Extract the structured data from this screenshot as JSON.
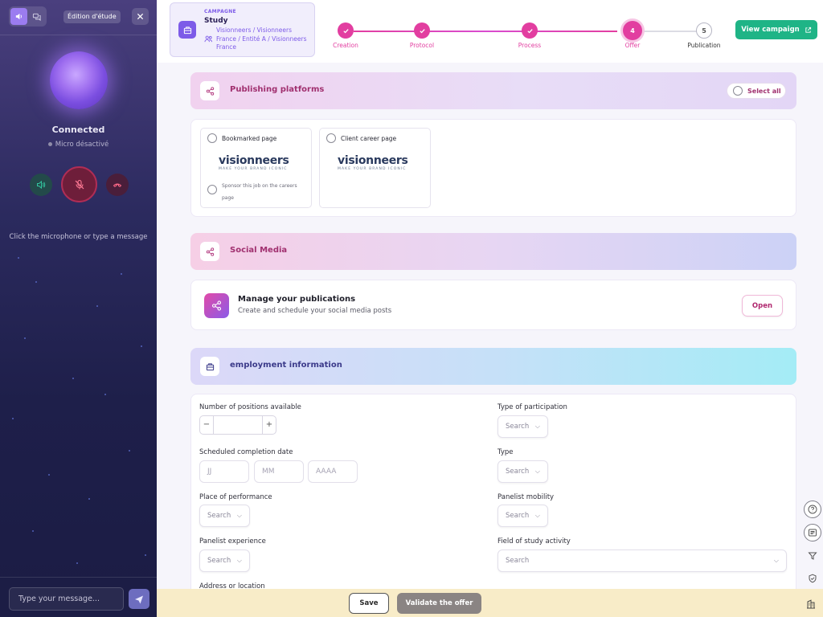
{
  "sidebar": {
    "edition_badge": "Édition d'étude",
    "status": "Connected",
    "mic_status": "Micro désactivé",
    "hint": "Click the microphone or type a message",
    "message_placeholder": "Type your message..."
  },
  "campaign": {
    "tag": "CAMPAGNE",
    "title": "Study",
    "path": "Visionneers / Visionneers France / Entité A / Visionneers France"
  },
  "steps": [
    {
      "label": "Creation",
      "state": "done"
    },
    {
      "label": "Protocol",
      "state": "done"
    },
    {
      "label": "Process",
      "state": "done"
    },
    {
      "label": "Offer",
      "number": "4",
      "state": "current"
    },
    {
      "label": "Publication",
      "number": "5",
      "state": "todo"
    }
  ],
  "view_campaign_label": "View campaign",
  "publishing": {
    "title": "Publishing platforms",
    "select_all": "Select all",
    "platforms": [
      {
        "label": "Bookmarked page",
        "logo": "visionneers",
        "logo_sub": "MAKE YOUR BRAND ICONIC",
        "sponsor": "Sponsor this job on the careers page"
      },
      {
        "label": "Client career page",
        "logo": "visionneers",
        "logo_sub": "MAKE YOUR BRAND ICONIC"
      }
    ]
  },
  "social": {
    "title": "Social Media",
    "manage_title": "Manage your publications",
    "manage_desc": "Create and schedule your social media posts",
    "open_label": "Open"
  },
  "employment": {
    "title": "employment information",
    "positions_label": "Number of positions available",
    "stepper_minus": "−",
    "stepper_plus": "+",
    "participation_label": "Type of participation",
    "completion_label": "Scheduled completion date",
    "date_day": "JJ",
    "date_month": "MM",
    "date_year": "AAAA",
    "type_label": "Type",
    "place_label": "Place of performance",
    "mobility_label": "Panelist mobility",
    "experience_label": "Panelist experience",
    "field_label": "Field of study activity",
    "address_label": "Address or location",
    "search_placeholder": "Search"
  },
  "footer": {
    "save_label": "Save",
    "validate_label": "Validate the offer"
  },
  "colors": {
    "accent_purple": "#7d5be8",
    "step_pink": "#e23ea0",
    "primary_green": "#1fb486"
  }
}
